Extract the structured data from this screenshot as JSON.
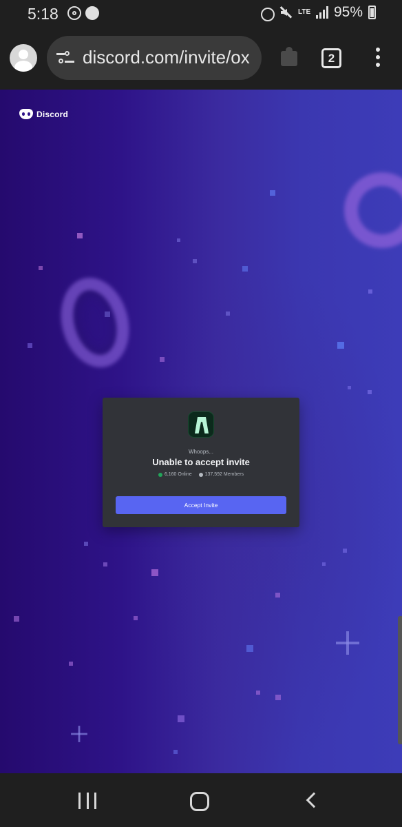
{
  "status_bar": {
    "time": "5:18",
    "network": "LTE",
    "battery": "95%"
  },
  "browser": {
    "url": "discord.com/invite/ox",
    "tab_count": "2"
  },
  "page": {
    "brand": "Discord",
    "invite": {
      "subtitle": "Whoops...",
      "title": "Unable to accept invite",
      "online": "6,160 Online",
      "members": "137,592 Members",
      "button_label": "Accept Invite"
    }
  },
  "colors": {
    "accent": "#5865f2",
    "online": "#23a55a",
    "card_bg": "#313338"
  }
}
